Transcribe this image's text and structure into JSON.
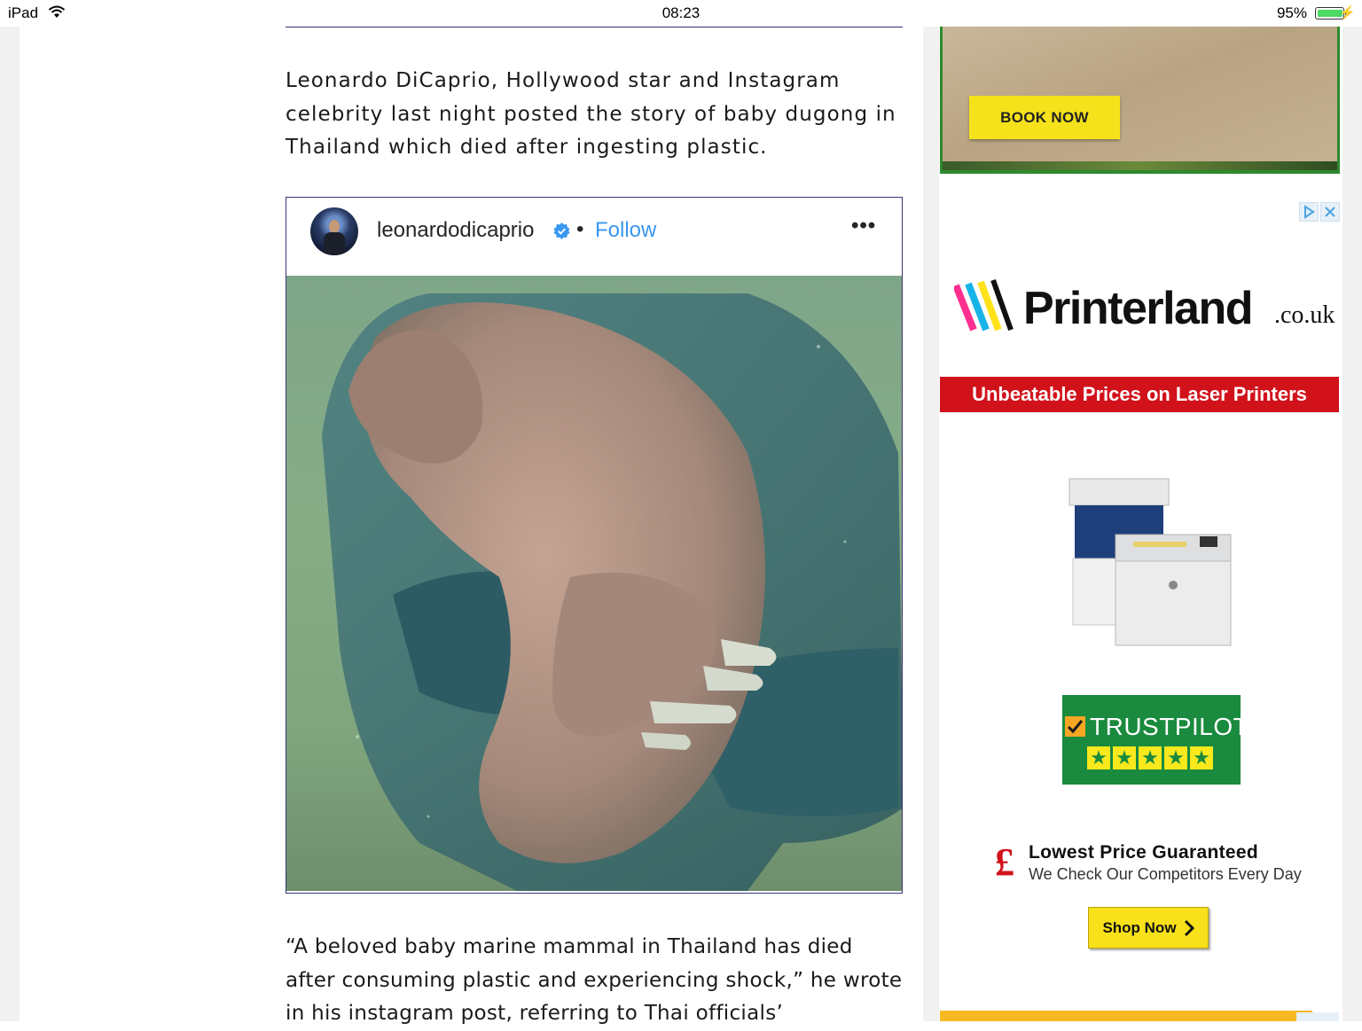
{
  "status_bar": {
    "device": "iPad",
    "time": "08:23",
    "battery": "95%",
    "battery_level": 0.95
  },
  "article": {
    "intro": "Leonardo DiCaprio, Hollywood star and Instagram celebrity last night posted the story of baby dugong in Thailand which died after ingesting plastic.",
    "quote": "“A beloved baby marine mammal in Thailand has died after consuming plastic and experiencing shock,” he wrote in his instagram post, referring to Thai officials’"
  },
  "instagram_embed": {
    "username": "leonardodicaprio",
    "separator": "•",
    "follow_label": "Follow",
    "more_label": "•••",
    "verified_icon": "verified-badge-icon",
    "accent_color": "#3897f0"
  },
  "ads": {
    "top_ad": {
      "button_label": "BOOK NOW"
    },
    "printerland": {
      "brand": "Printerland",
      "tld": ".co.uk",
      "banner": "Unbeatable Prices on Laser Printers",
      "trustpilot_label": "TRUSTPILOT",
      "guarantee_symbol": "£",
      "guarantee_title": "Lowest Price Guaranteed",
      "guarantee_subtitle": "We Check Our Competitors Every Day",
      "shop_button_label": "Shop Now",
      "brand_red": "#d1121b",
      "trustpilot_green": "#1a8a3e"
    }
  }
}
